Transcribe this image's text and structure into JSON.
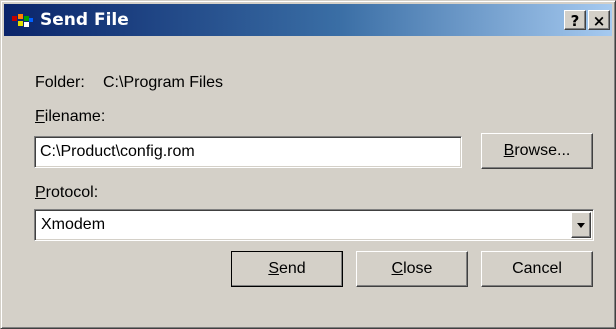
{
  "window": {
    "title": "Send File",
    "help_label": "?",
    "close_label": "×"
  },
  "folder": {
    "label": "Folder:",
    "value": "C:\\Program Files"
  },
  "filename": {
    "label_accel": "F",
    "label_rest": "ilename:",
    "value": "C:\\Product\\config.rom"
  },
  "browse": {
    "label_accel": "B",
    "label_rest": "rowse..."
  },
  "protocol": {
    "label_accel": "P",
    "label_rest": "rotocol:",
    "selected": "Xmodem"
  },
  "buttons": {
    "send_accel": "S",
    "send_rest": "end",
    "close_accel": "C",
    "close_rest": "lose",
    "cancel_label": "Cancel"
  },
  "colors": {
    "titlebar_start": "#0a246a",
    "titlebar_end": "#a6caf0",
    "dialog_face": "#d4d0c8"
  },
  "icons": {
    "app": "app-icon",
    "combo_arrow": "chevron-down-icon"
  }
}
